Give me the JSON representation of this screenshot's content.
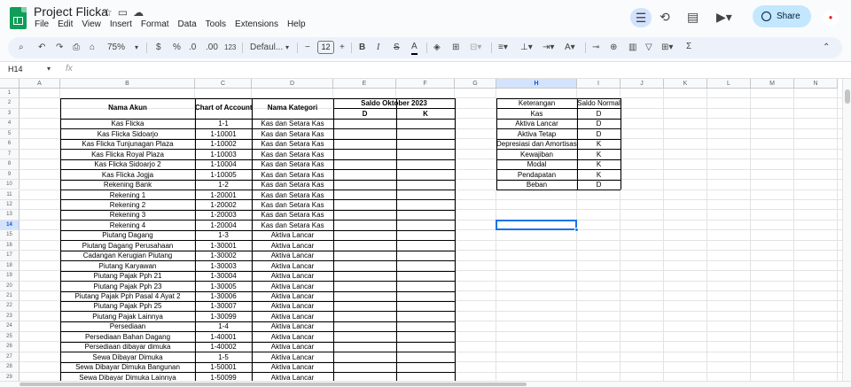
{
  "app": {
    "title": "Project Flicka",
    "menu": [
      "File",
      "Edit",
      "View",
      "Insert",
      "Format",
      "Data",
      "Tools",
      "Extensions",
      "Help"
    ],
    "share_label": "Share",
    "name_box": "H14",
    "colors": {
      "logo": "#0f9d58",
      "selection": "#1a73e8",
      "share_bg": "#c2e7ff",
      "header_sel": "#d3e3fd"
    }
  },
  "toolbar": {
    "zoom": "75%",
    "currency": "$",
    "percent": "%",
    "dec_less": ".0",
    "dec_more": ".00",
    "num_format": "123",
    "font": "Defaul...",
    "font_size": "12",
    "bold": "B",
    "italic": "I",
    "text_color": "A",
    "function": "Σ",
    "icons": [
      "search-icon",
      "undo-icon",
      "redo-icon",
      "print-icon",
      "paint-format-icon",
      "borders-icon",
      "merge-icon",
      "align-icon",
      "valign-icon",
      "wrap-icon",
      "rotate-icon",
      "link-icon",
      "comment-icon",
      "chart-icon",
      "filter-icon",
      "filter-views-icon",
      "function-icon",
      "collapse-icon"
    ]
  },
  "columns": [
    "A",
    "B",
    "C",
    "D",
    "E",
    "F",
    "G",
    "H",
    "I",
    "J",
    "K",
    "L",
    "M",
    "N"
  ],
  "rows": [
    "1",
    "2",
    "3",
    "4",
    "5",
    "6",
    "7",
    "8",
    "9",
    "10",
    "11",
    "12",
    "13",
    "14",
    "15",
    "16",
    "17",
    "18",
    "19",
    "20",
    "21",
    "22",
    "23",
    "24",
    "25",
    "26",
    "27",
    "28",
    "29"
  ],
  "table1": {
    "header_nama": "Nama Akun",
    "header_coa": "Chart of Account",
    "header_kat": "Nama Kategori",
    "header_saldo": "Saldo Oktober 2023",
    "header_d": "D",
    "header_k": "K",
    "rows": [
      [
        "Kas Flicka",
        "1-1",
        "Kas dan Setara Kas"
      ],
      [
        "Kas Flicka Sidoarjo",
        "1-10001",
        "Kas dan Setara Kas"
      ],
      [
        "Kas Flicka Tunjunagan Plaza",
        "1-10002",
        "Kas dan Setara Kas"
      ],
      [
        "Kas Flicka Royal Plaza",
        "1-10003",
        "Kas dan Setara Kas"
      ],
      [
        "Kas Flicka Sidoarjo 2",
        "1-10004",
        "Kas dan Setara Kas"
      ],
      [
        "Kas Flicka Jogja",
        "1-10005",
        "Kas dan Setara Kas"
      ],
      [
        "Rekening Bank",
        "1-2",
        "Kas dan Setara Kas"
      ],
      [
        "Rekening 1",
        "1-20001",
        "Kas dan Setara Kas"
      ],
      [
        "Rekening 2",
        "1-20002",
        "Kas dan Setara Kas"
      ],
      [
        "Rekening 3",
        "1-20003",
        "Kas dan Setara Kas"
      ],
      [
        "Rekening 4",
        "1-20004",
        "Kas dan Setara Kas"
      ],
      [
        "Piutang Dagang",
        "1-3",
        "Aktiva Lancar"
      ],
      [
        "Piutang Dagang Perusahaan",
        "1-30001",
        "Aktiva Lancar"
      ],
      [
        "Cadangan Kerugian Piutang",
        "1-30002",
        "Aktiva Lancar"
      ],
      [
        "Piutang Karyawan",
        "1-30003",
        "Aktiva Lancar"
      ],
      [
        "Piutang Pajak Pph 21",
        "1-30004",
        "Aktiva Lancar"
      ],
      [
        "Piutang Pajak Pph 23",
        "1-30005",
        "Aktiva Lancar"
      ],
      [
        "Piutang Pajak Pph Pasal 4 Ayat 2",
        "1-30006",
        "Aktiva Lancar"
      ],
      [
        "Piutang Pajak Pph 25",
        "1-30007",
        "Aktiva Lancar"
      ],
      [
        "Piutang Pajak Lainnya",
        "1-30099",
        "Aktiva Lancar"
      ],
      [
        "Persediaan",
        "1-4",
        "Aktiva Lancar"
      ],
      [
        "Persediaan Bahan Dagang",
        "1-40001",
        "Aktiva Lancar"
      ],
      [
        "Persediaan dibayar dimuka",
        "1-40002",
        "Aktiva Lancar"
      ],
      [
        "Sewa Dibayar Dimuka",
        "1-5",
        "Aktiva Lancar"
      ],
      [
        "Sewa Dibayar Dimuka Bangunan",
        "1-50001",
        "Aktiva Lancar"
      ],
      [
        "Sewa Dibayar Dimuka Lainnya",
        "1-50099",
        "Aktiva Lancar"
      ]
    ]
  },
  "table2": {
    "header_ket": "Keterangan",
    "header_saldo": "Saldo Normal",
    "rows": [
      [
        "Kas",
        "D"
      ],
      [
        "Aktiva Lancar",
        "D"
      ],
      [
        "Aktiva Tetap",
        "D"
      ],
      [
        "Depresiasi dan Amortisasi",
        "K"
      ],
      [
        "Kewajiban",
        "K"
      ],
      [
        "Modal",
        "K"
      ],
      [
        "Pendapatan",
        "K"
      ],
      [
        "Beban",
        "D"
      ]
    ]
  }
}
